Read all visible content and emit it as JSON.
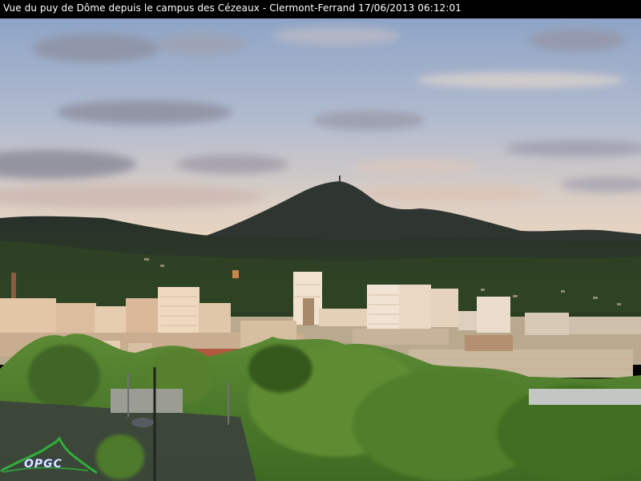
{
  "caption": {
    "text": "Vue du puy de Dôme depuis le campus des Cézeaux - Clermont-Ferrand 17/06/2013 06:12:01"
  },
  "logo": {
    "text": "OPGC",
    "color": "#2fae3a"
  },
  "colors": {
    "sky_top": "#8fa6c8",
    "sky_horizon": "#e9d2bc",
    "mountain": "#2e3530",
    "hills": "#2d3a25",
    "buildings": "#e8cfb0",
    "trees": "#4c7a2c"
  }
}
